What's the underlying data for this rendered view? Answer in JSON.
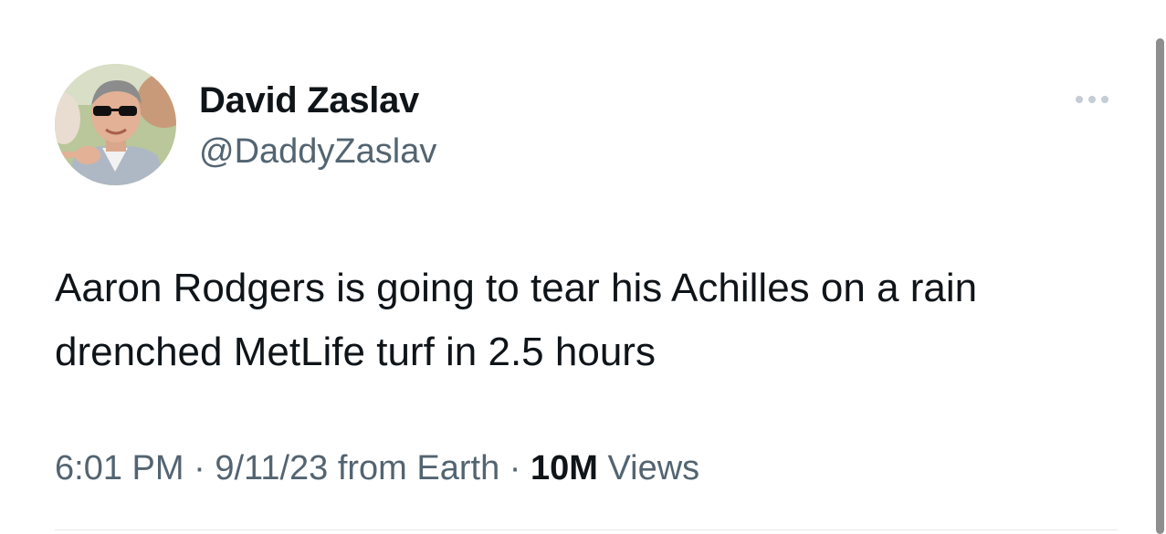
{
  "tweet": {
    "author": {
      "display_name": "David Zaslav",
      "handle": "@DaddyZaslav"
    },
    "text": "Aaron Rodgers is going to tear his Achilles on a rain drenched MetLife turf in 2.5 hours",
    "meta": {
      "time": "6:01 PM",
      "separator": " · ",
      "date": "9/11/23",
      "source": " from Earth",
      "views_count": "10M",
      "views_label": " Views"
    },
    "more_icon": "more-horizontal-icon"
  },
  "colors": {
    "text_primary": "#0f1419",
    "text_secondary": "#536471",
    "more_dots": "#c5ccd3"
  }
}
